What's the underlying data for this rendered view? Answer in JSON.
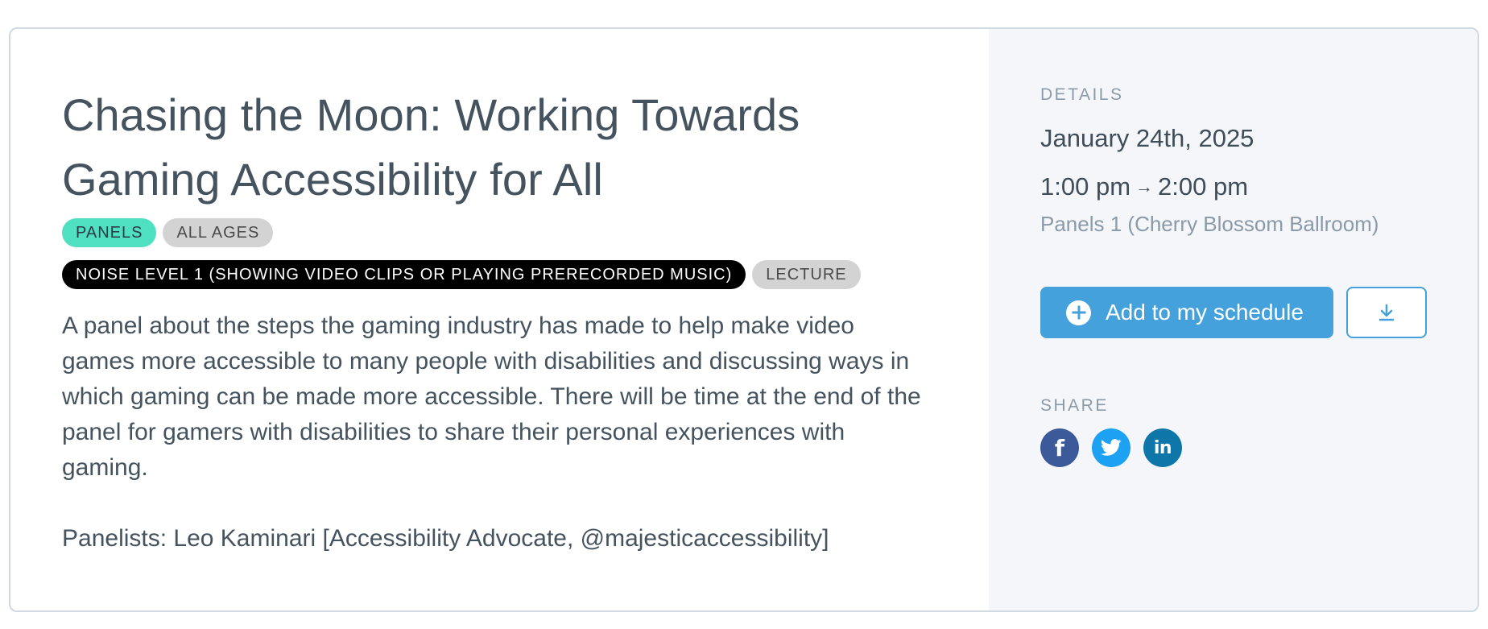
{
  "session": {
    "title": "Chasing the Moon: Working Towards Gaming Accessibility for All",
    "tags_row1": [
      {
        "label": "PANELS",
        "style": "green"
      },
      {
        "label": "ALL AGES",
        "style": "grey"
      }
    ],
    "tags_row2": [
      {
        "label": "NOISE LEVEL 1 (SHOWING VIDEO CLIPS OR PLAYING PRERECORDED MUSIC)",
        "style": "black"
      },
      {
        "label": "LECTURE",
        "style": "grey"
      }
    ],
    "description": "A panel about the steps the gaming industry has made to help make video games more accessible to many people with disabilities and discussing ways in which gaming can be made more accessible. There will be time at the end of the panel for gamers with disabilities to share their personal experiences with gaming.",
    "panelists": "Panelists: Leo Kaminari [Accessibility Advocate, @majesticaccessibility]"
  },
  "details": {
    "label": "DETAILS",
    "date": "January 24th, 2025",
    "start_time": "1:00 pm",
    "arrow": "→",
    "end_time": "2:00 pm",
    "location": "Panels 1 (Cherry Blossom Ballroom)"
  },
  "actions": {
    "add_label": "Add to my schedule",
    "add_icon": "plus-circle-icon",
    "download_icon": "download-icon"
  },
  "share": {
    "label": "SHARE",
    "facebook_glyph": "f",
    "linkedin_glyph": "in"
  },
  "colors": {
    "accent": "#45a1db",
    "tag_green": "#4fe0c1",
    "tag_grey": "#d3d3d3",
    "tag_black": "#000000",
    "facebook": "#3c5a99",
    "twitter": "#1da1f2",
    "linkedin": "#0e76a8",
    "sidebar_bg": "#f4f6f9"
  }
}
